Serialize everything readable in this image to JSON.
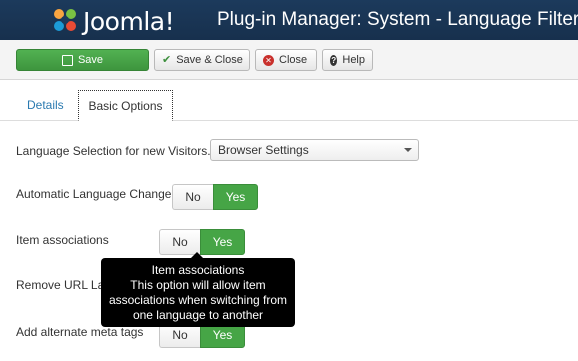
{
  "header": {
    "logo_text": "Joomla!",
    "title": "Plug-in Manager: System - Language Filter"
  },
  "toolbar": {
    "save_label": "Save",
    "save_close_label": "Save & Close",
    "close_label": "Close",
    "help_label": "Help"
  },
  "tabs": [
    {
      "label": "Details",
      "active": false
    },
    {
      "label": "Basic Options",
      "active": true
    }
  ],
  "form": {
    "language_selection": {
      "label": "Language Selection for new Visitors.",
      "value": "Browser Settings"
    },
    "automatic_language_change": {
      "label": "Automatic Language Change",
      "no": "No",
      "yes": "Yes",
      "selected": "Yes"
    },
    "item_associations": {
      "label": "Item associations",
      "no": "No",
      "yes": "Yes",
      "selected": "Yes"
    },
    "remove_url_language": {
      "label": "Remove URL La"
    },
    "alternate_meta_tags": {
      "label": "Add alternate meta tags",
      "no": "No",
      "yes": "Yes",
      "selected": "Yes"
    }
  },
  "tooltip": {
    "title": "Item associations",
    "line1": "This option will allow item",
    "line2": "associations when switching from",
    "line3": "one language to another"
  },
  "colors": {
    "header_bg": "#1c3a5c",
    "save_green": "#46a546",
    "toggle_yes": "#46a546",
    "link_blue": "#2a7ab0",
    "tooltip_bg": "#000000"
  }
}
